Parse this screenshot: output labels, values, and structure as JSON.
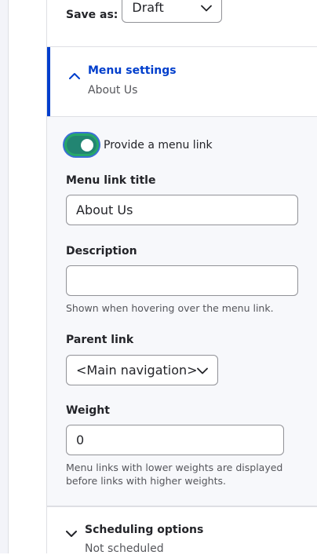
{
  "save": {
    "label": "Save as:",
    "selected": "Draft"
  },
  "menu_settings": {
    "title": "Menu settings",
    "summary": "About Us",
    "provide_link_label": "Provide a menu link",
    "provide_link_checked": true,
    "link_title": {
      "label": "Menu link title",
      "value": "About Us"
    },
    "description": {
      "label": "Description",
      "value": "",
      "help": "Shown when hovering over the menu link."
    },
    "parent_link": {
      "label": "Parent link",
      "selected": "<Main navigation>"
    },
    "weight": {
      "label": "Weight",
      "value": "0",
      "help_line1": "Menu links with lower weights are displayed",
      "help_line2": "before links with higher weights."
    }
  },
  "scheduling": {
    "title": "Scheduling options",
    "summary": "Not scheduled"
  },
  "colors": {
    "accent": "#003ecc",
    "toggle_on": "#228572"
  },
  "icons": {
    "save_chevron": "chevron-down-icon",
    "menu_chevron": "chevron-up-icon",
    "parent_chevron": "chevron-down-icon",
    "schedule_chevron": "chevron-down-icon"
  }
}
